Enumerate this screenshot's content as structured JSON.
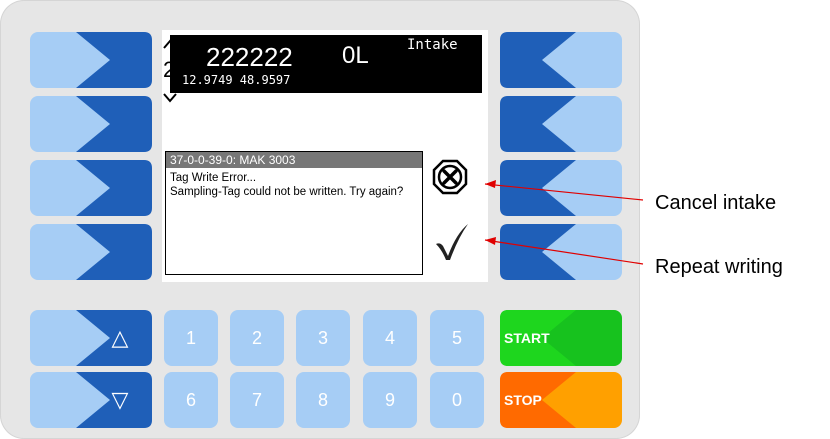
{
  "screen": {
    "header": {
      "code": "222222",
      "volume": "0L",
      "mode": "Intake",
      "coordinates": "12.9749  48.9597",
      "page_number": "2"
    },
    "dialog": {
      "title": "37-0-0-39-0: MAK 3003",
      "message_line1": "Tag Write Error...",
      "message_line2": "Sampling-Tag could not be written. Try again?"
    }
  },
  "keypad": {
    "row1": [
      "1",
      "2",
      "3",
      "4",
      "5"
    ],
    "row2": [
      "6",
      "7",
      "8",
      "9",
      "0"
    ],
    "up_arrow": "△",
    "down_arrow": "▽",
    "start_label": "START",
    "stop_label": "STOP"
  },
  "annotations": {
    "cancel": "Cancel intake",
    "repeat": "Repeat writing"
  },
  "colors": {
    "key_light": "#a6cdf5",
    "key_dark": "#1f5fb8",
    "start": "#17c21e",
    "stop": "#ff7a00",
    "annotation_line": "#e00000"
  },
  "icons": {
    "cancel": "cancel-x-icon",
    "confirm": "checkmark-icon",
    "page_up": "chevron-up-icon",
    "page_down": "chevron-down-icon"
  }
}
